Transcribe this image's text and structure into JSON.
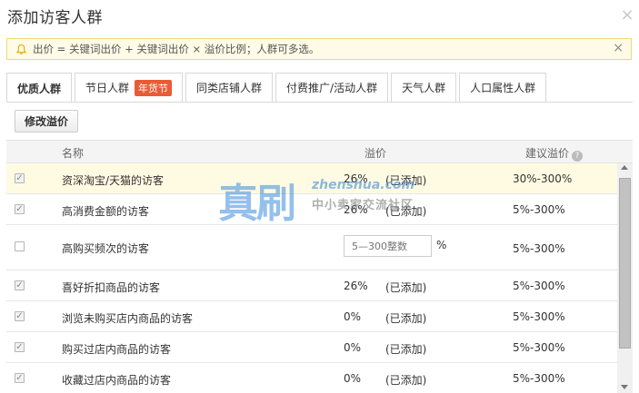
{
  "dialog": {
    "title": "添加访客人群",
    "close_label": "×"
  },
  "notice": {
    "text": "出价 = 关键词出价 + 关键词出价 × 溢价比例；人群可多选。",
    "close_label": "×",
    "icon": "bell-icon"
  },
  "tabs": [
    {
      "label": "优质人群",
      "active": true
    },
    {
      "label": "节日人群",
      "badge": "年货节"
    },
    {
      "label": "同类店铺人群"
    },
    {
      "label": "付费推广/活动人群"
    },
    {
      "label": "天气人群"
    },
    {
      "label": "人口属性人群"
    }
  ],
  "toolbar": {
    "modify_label": "修改溢价"
  },
  "table": {
    "columns": {
      "name": "名称",
      "premium": "溢价",
      "suggest": "建议溢价",
      "help": "?"
    },
    "rows": [
      {
        "checked": true,
        "name": "资深淘宝/天猫的访客",
        "rate": "26%",
        "status": "(已添加)",
        "suggest": "30%-300%",
        "highlight": true
      },
      {
        "checked": true,
        "name": "高消费金额的访客",
        "rate": "26%",
        "status": "(已添加)",
        "suggest": "5%-300%"
      },
      {
        "checked": false,
        "name": "高购买频次的访客",
        "input_placeholder": "5—300整数",
        "unit": "%",
        "suggest": "5%-300%"
      },
      {
        "checked": true,
        "name": "喜好折扣商品的访客",
        "rate": "26%",
        "status": "(已添加)",
        "suggest": "5%-300%"
      },
      {
        "checked": true,
        "name": "浏览未购买店内商品的访客",
        "rate": "0%",
        "status": "(已添加)",
        "suggest": "5%-300%"
      },
      {
        "checked": true,
        "name": "购买过店内商品的访客",
        "rate": "0%",
        "status": "(已添加)",
        "suggest": "5%-300%"
      },
      {
        "checked": true,
        "name": "收藏过店内商品的访客",
        "rate": "0%",
        "status": "(已添加)",
        "suggest": "5%-300%"
      }
    ]
  },
  "watermark": {
    "big": "真刷",
    "url": "zhenshua.com",
    "sub": "中小卖家交流社区"
  },
  "colors": {
    "badge": "#e85c35",
    "notice_bg": "#fffbe6",
    "highlight_row": "#fffbe3"
  }
}
